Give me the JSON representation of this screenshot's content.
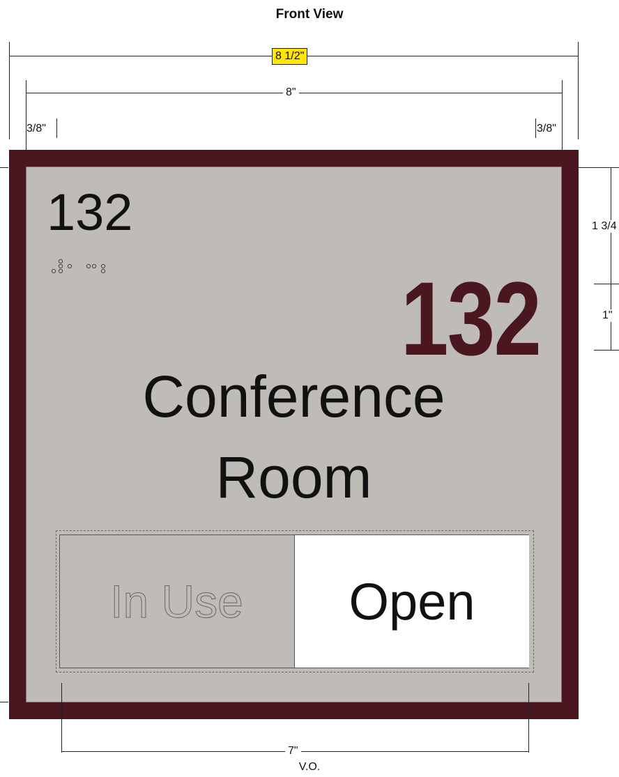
{
  "view_title": "Front View",
  "dimensions": {
    "overall_width": "8 1/2\"",
    "face_width": "8\"",
    "border_left": "3/8\"",
    "border_right": "3/8\"",
    "top_to_number": "1 3/4",
    "number_height": "1\"",
    "window_width": "7\"",
    "window_note": "V.O."
  },
  "sign": {
    "room_number_tactile": "132",
    "room_number_visual": "132",
    "room_name_line1": "Conference",
    "room_name_line2": "Room",
    "status_in_use": "In Use",
    "status_open": "Open"
  },
  "colors": {
    "frame": "#4a1620",
    "face": "#bfbcb8",
    "highlight": "#ffe600"
  },
  "icons": {
    "braille": "braille-dots"
  }
}
